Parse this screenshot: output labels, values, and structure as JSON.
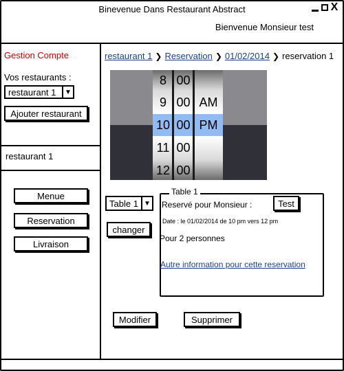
{
  "window": {
    "title": "Binevenue Dans Restaurant Abstract",
    "welcome": "Bienvenue Monsieur test",
    "close_glyph": "X"
  },
  "sidebar": {
    "account_link": "Gestion Compte",
    "account_color": "#cc0000",
    "restaurants_label": "Vos restaurants :",
    "restaurant_select": "restaurant 1",
    "add_restaurant_label": "Ajouter restaurant",
    "current_restaurant": "restaurant 1",
    "menu_buttons": [
      {
        "label": "Menue"
      },
      {
        "label": "Reservation"
      },
      {
        "label": "Livraison"
      }
    ]
  },
  "breadcrumb": {
    "items": [
      "restaurant 1",
      "Reservation",
      "01/02/2014"
    ],
    "current": "reservation 1"
  },
  "time_picker": {
    "hours": [
      "8",
      "9",
      "10",
      "11",
      "12"
    ],
    "minutes": [
      "00",
      "00",
      "00",
      "00",
      "00"
    ],
    "periods": [
      "AM",
      "PM"
    ],
    "selected": {
      "hour": "10",
      "minute": "00",
      "period": "PM"
    },
    "highlight_color": "#78aaf0"
  },
  "table": {
    "select_value": "Table 1",
    "change_label": "changer",
    "legend": "Table 1",
    "reserved_for_label": "Reservé pour Monsieur :",
    "reserved_for_name": "Test",
    "date_text": "Date : le 01/02/2014 de 10 pm vers 12 pm",
    "persons_text": "Pour 2 personnes",
    "more_info_link": "Autre information pour cette reservation"
  },
  "actions": {
    "modify_label": "Modifier",
    "delete_label": "Supprimer"
  }
}
